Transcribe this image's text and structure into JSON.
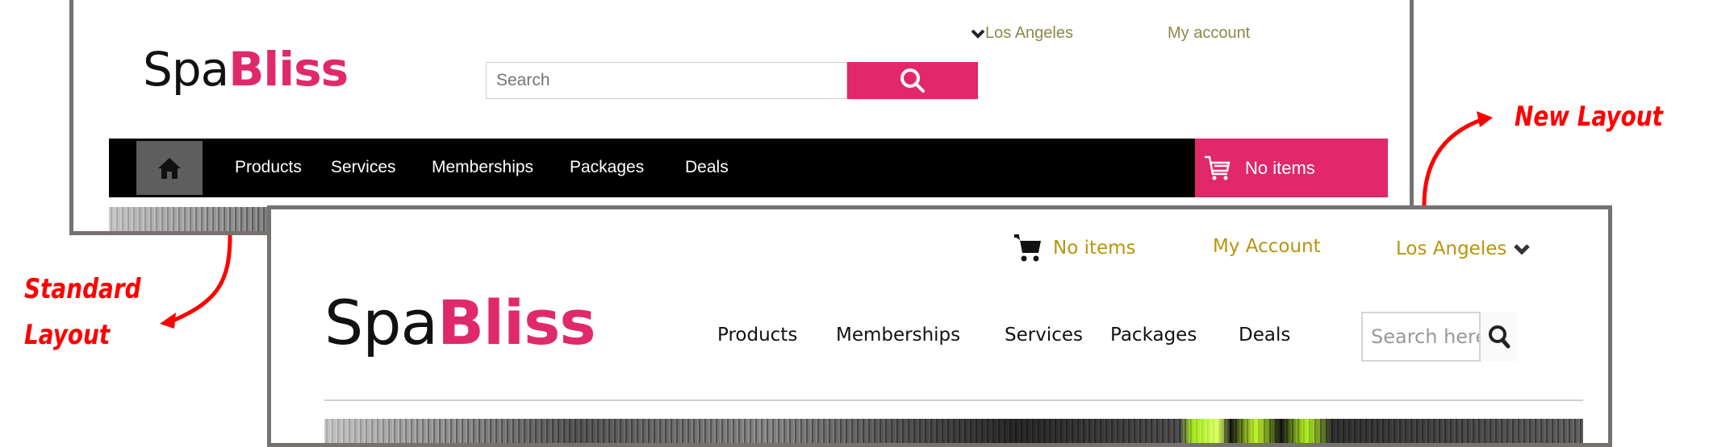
{
  "annotations": {
    "standard_label_line1": "Standard",
    "standard_label_line2": "Layout",
    "new_label": "New Layout",
    "arrow_color": "#ff0000"
  },
  "standard_layout": {
    "logo": {
      "part1": "Spa",
      "part2": "Bliss"
    },
    "top_links": {
      "location": "Los Angeles",
      "account": "My account"
    },
    "search": {
      "placeholder": "Search",
      "button_icon": "search-icon"
    },
    "nav": {
      "home_icon": "home-icon",
      "items": [
        {
          "label": "Products"
        },
        {
          "label": "Services"
        },
        {
          "label": "Memberships"
        },
        {
          "label": "Packages"
        },
        {
          "label": "Deals"
        }
      ],
      "cart": {
        "icon": "cart-icon",
        "label": "No items"
      }
    },
    "colors": {
      "accent": "#e0286a",
      "nav_bg": "#000000",
      "link": "#8a8a4a"
    }
  },
  "new_layout": {
    "logo": {
      "part1": "Spa",
      "part2": "Bliss"
    },
    "top_links": {
      "cart_label": "No items",
      "account": "My Account",
      "location": "Los Angeles"
    },
    "nav": {
      "items": [
        {
          "label": "Products"
        },
        {
          "label": "Memberships"
        },
        {
          "label": "Services"
        },
        {
          "label": "Packages"
        },
        {
          "label": "Deals"
        }
      ]
    },
    "search": {
      "placeholder": "Search here..",
      "button_icon": "search-icon"
    },
    "colors": {
      "accent": "#e0296b",
      "link": "#b8940e"
    }
  }
}
